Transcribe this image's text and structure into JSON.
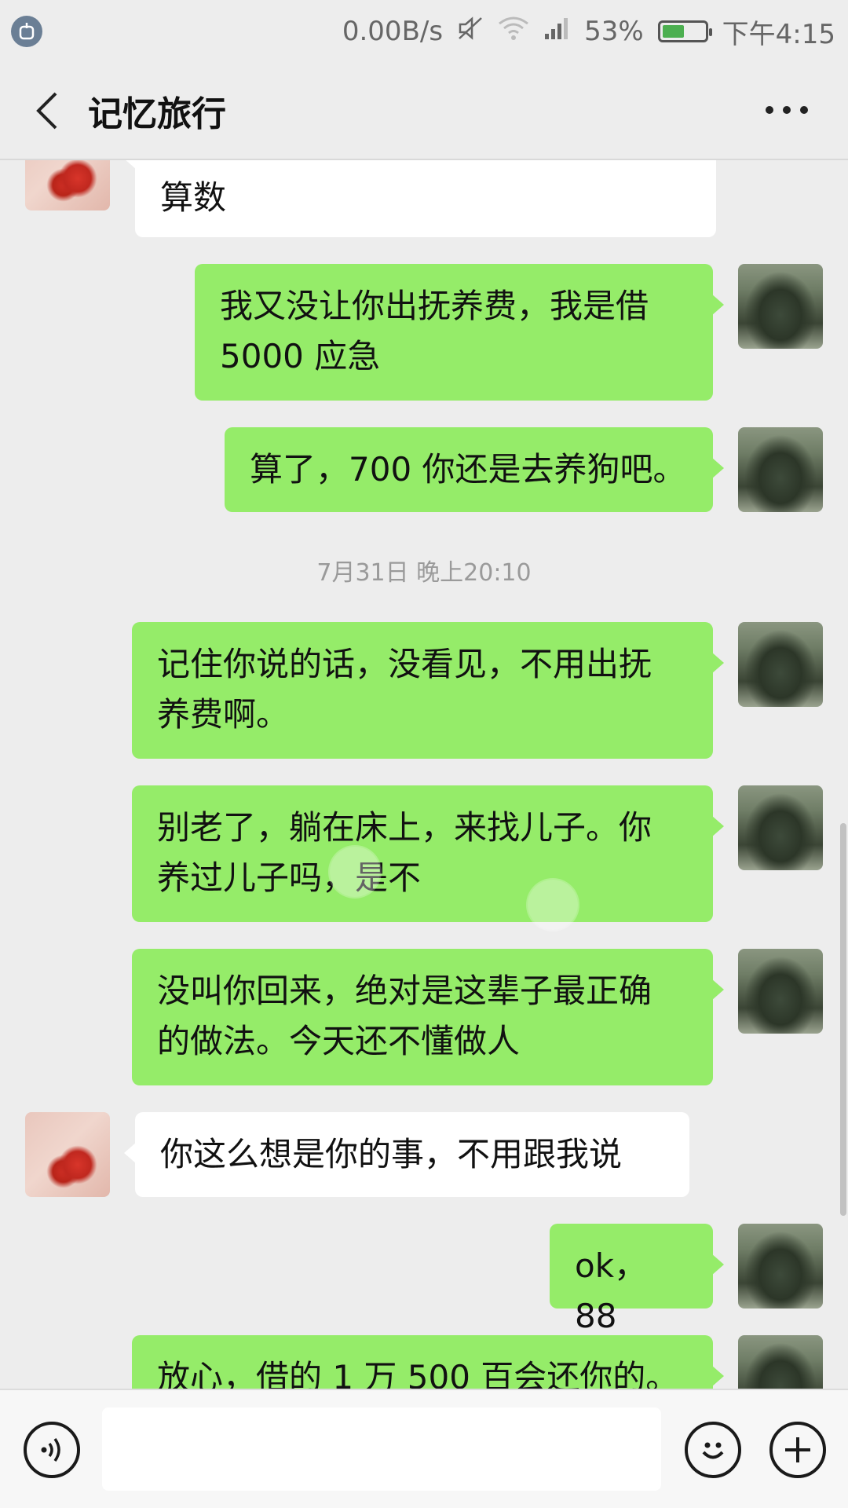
{
  "status_bar": {
    "net_speed": "0.00B/s",
    "battery_percent": "53%",
    "battery_level": 0.53,
    "time": "下午4:15"
  },
  "header": {
    "title": "记忆旅行",
    "back_icon": "chevron-left-icon",
    "more_icon": "more-horizontal-icon"
  },
  "messages": [
    {
      "from": "theirs",
      "text": "算数"
    },
    {
      "from": "me",
      "text": "我又没让你出抚养费，我是借\n5000 应急"
    },
    {
      "from": "me",
      "text": "算了，700 你还是去养狗吧。"
    },
    {
      "from": "me",
      "text": "记住你说的话，没看见，不用出抚\n养费啊。"
    },
    {
      "from": "me",
      "text": "别老了，躺在床上，来找儿子。你\n养过儿子吗，是不"
    },
    {
      "from": "me",
      "text": "没叫你回来，绝对是这辈子最正确\n的做法。今天还不懂做人"
    },
    {
      "from": "theirs",
      "text": "你这么想是你的事，不用跟我说"
    },
    {
      "from": "me",
      "text": "ok，88"
    },
    {
      "from": "me",
      "text": "放心，借的 1 万 500 百会还你的。"
    }
  ],
  "timestamp": "7月31日 晚上20:10",
  "input_bar": {
    "voice_icon": "voice-icon",
    "emoji_icon": "emoji-icon",
    "plus_icon": "plus-icon",
    "input_value": ""
  },
  "colors": {
    "my_bubble": "#95ec69",
    "their_bubble": "#ffffff",
    "background": "#ededed"
  }
}
